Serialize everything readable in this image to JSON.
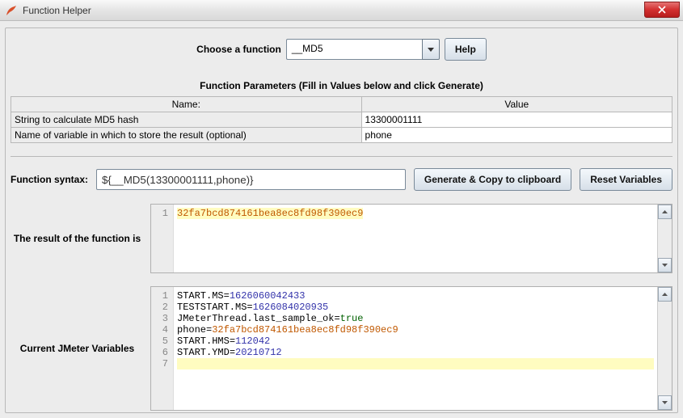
{
  "window": {
    "title": "Function Helper"
  },
  "selector": {
    "label": "Choose a function",
    "value": "__MD5",
    "help_label": "Help"
  },
  "params_title": "Function Parameters (Fill in Values below and click Generate)",
  "params_table": {
    "header_name": "Name:",
    "header_value": "Value",
    "rows": [
      {
        "name": "String to calculate MD5 hash",
        "value": "13300001111"
      },
      {
        "name": "Name of variable in which to store the result (optional)",
        "value": "phone"
      }
    ]
  },
  "syntax": {
    "label": "Function syntax:",
    "value": "${__MD5(13300001111,phone)}",
    "generate_label": "Generate & Copy to clipboard",
    "reset_label": "Reset Variables"
  },
  "result": {
    "label": "The result of the function is",
    "gutter": "1",
    "value": "32fa7bcd874161bea8ec8fd98f390ec9"
  },
  "vars": {
    "label": "Current JMeter Variables",
    "lines": [
      {
        "ln": "1",
        "k": "START.MS",
        "v": "1626060042433",
        "t": "num"
      },
      {
        "ln": "2",
        "k": "TESTSTART.MS",
        "v": "1626084020935",
        "t": "num"
      },
      {
        "ln": "3",
        "k": "JMeterThread.last_sample_ok",
        "v": "true",
        "t": "bool"
      },
      {
        "ln": "4",
        "k": "phone",
        "v": "32fa7bcd874161bea8ec8fd98f390ec9",
        "t": "str"
      },
      {
        "ln": "5",
        "k": "START.HMS",
        "v": "112042",
        "t": "num"
      },
      {
        "ln": "6",
        "k": "START.YMD",
        "v": "20210712",
        "t": "num"
      }
    ],
    "cursor_line": "7"
  }
}
